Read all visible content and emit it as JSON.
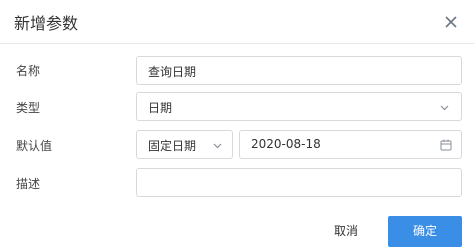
{
  "dialog": {
    "title": "新增参数",
    "close_icon": "close-icon"
  },
  "form": {
    "name": {
      "label": "名称",
      "value": "查询日期"
    },
    "type": {
      "label": "类型",
      "value": "日期",
      "icon": "chevron-down-icon"
    },
    "default": {
      "label": "默认值",
      "mode_value": "固定日期",
      "mode_icon": "chevron-down-icon",
      "date_value": "2020-08-18",
      "date_icon": "calendar-icon"
    },
    "description": {
      "label": "描述",
      "value": ""
    }
  },
  "footer": {
    "cancel_label": "取消",
    "confirm_label": "确定"
  },
  "colors": {
    "primary": "#3a8ee6",
    "border": "#d6d9de",
    "divider": "#e8e8e8"
  }
}
